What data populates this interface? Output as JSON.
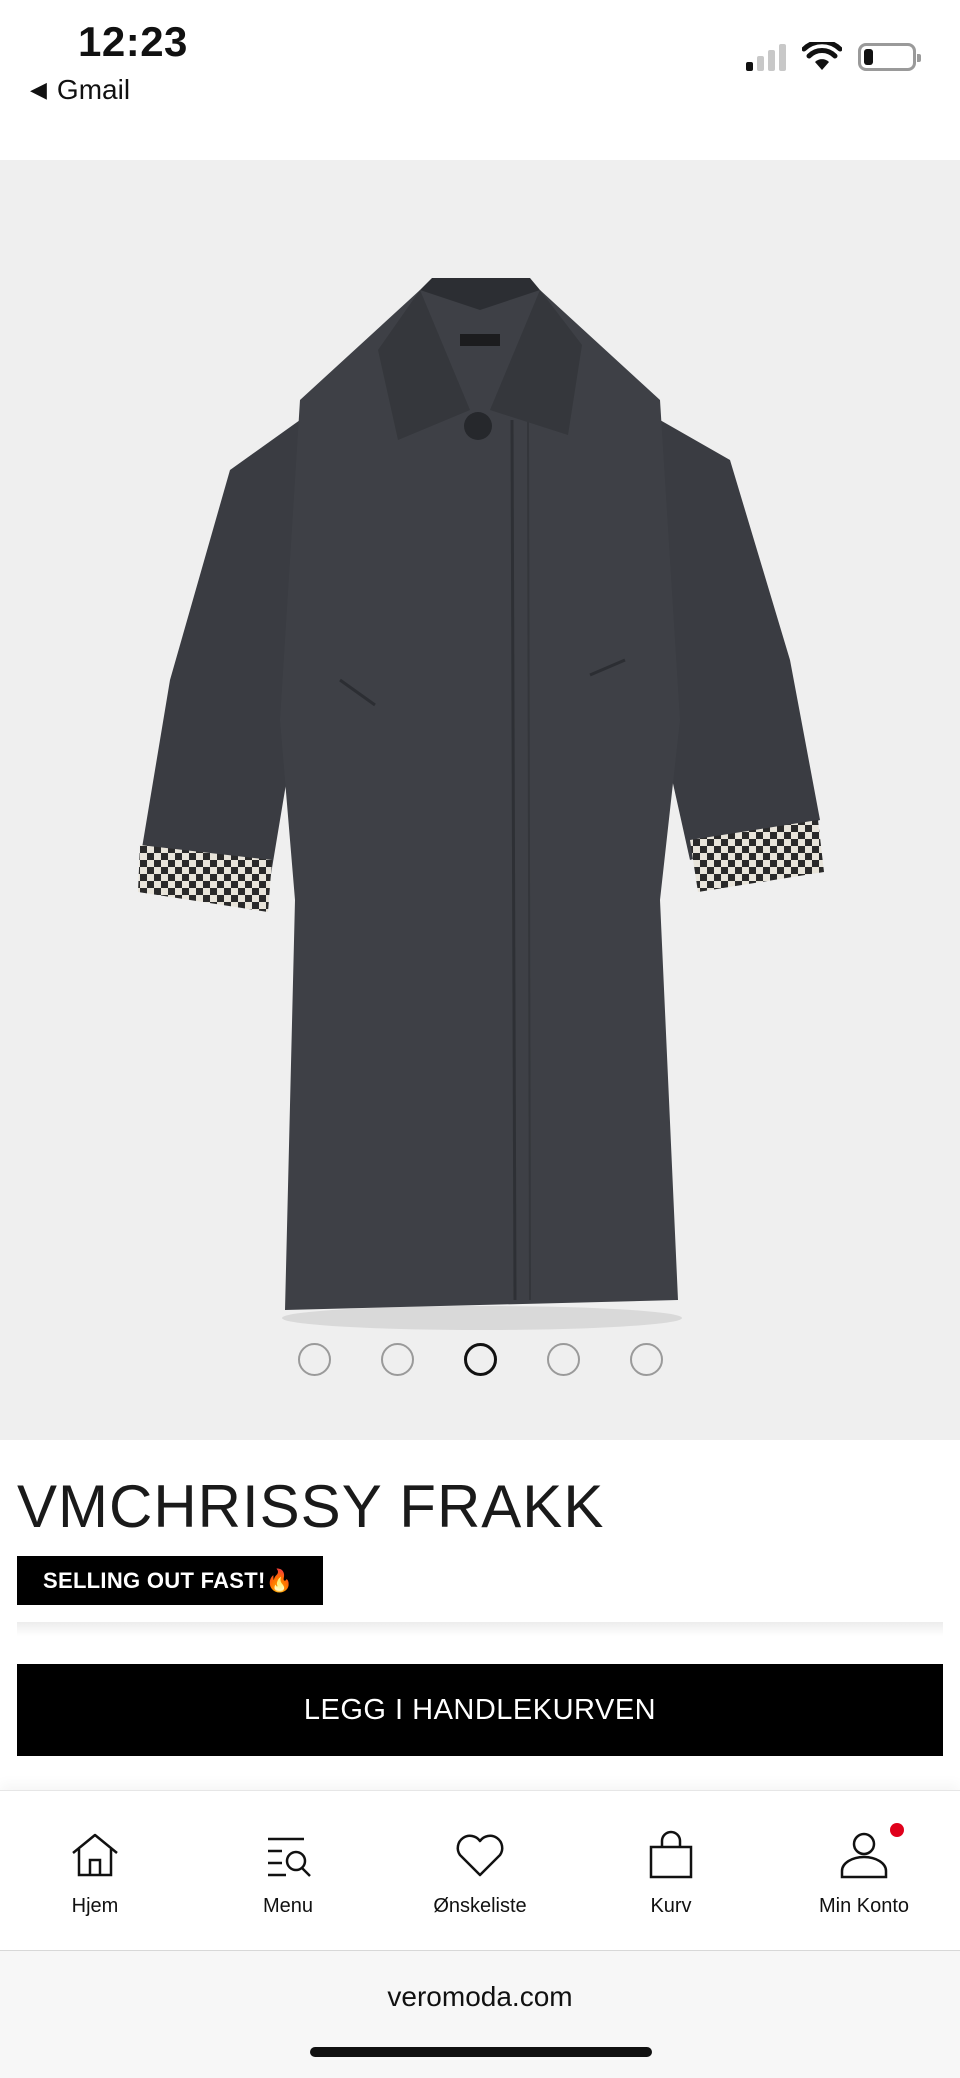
{
  "status_bar": {
    "time": "12:23",
    "back_app": "Gmail",
    "back_icon": "back-triangle-icon",
    "signal_icon": "cellular-signal-icon",
    "wifi_icon": "wifi-icon",
    "battery_icon": "battery-icon"
  },
  "gallery": {
    "image": "dark grey long coat with checked cuffs",
    "slide_count": 5,
    "active_slide": 3
  },
  "product": {
    "title": "VMCHRISSY FRAKK",
    "badge": "SELLING OUT FAST!🔥",
    "add_to_cart_label": "LEGG I HANDLEKURVEN"
  },
  "bottom_nav": {
    "items": [
      {
        "label": "Hjem",
        "icon": "home-icon"
      },
      {
        "label": "Menu",
        "icon": "menu-search-icon"
      },
      {
        "label": "Ønskeliste",
        "icon": "heart-icon"
      },
      {
        "label": "Kurv",
        "icon": "shopping-bag-icon"
      },
      {
        "label": "Min Konto",
        "icon": "user-icon"
      }
    ],
    "notification_color": "#e0001b"
  },
  "browser": {
    "url": "veromoda.com"
  },
  "colors": {
    "accent": "#000000",
    "gallery_bg": "#efefef",
    "coat": "#3c3e44"
  }
}
